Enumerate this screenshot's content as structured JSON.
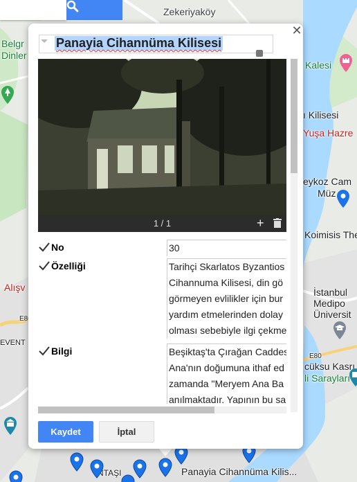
{
  "map": {
    "labels": {
      "zekeriyakoy": "Zekeriyaköy",
      "belgrad": "Belgr",
      "dinler": "Dinler",
      "kalesi": "Kalesi",
      "kilisesi": "ı Kilisesi",
      "yusa": "Yuşa Hazre",
      "beykoz": "eykoz Cam",
      "muze": "Müz",
      "koimisis": "Koimisis The",
      "alisveris": "Alışv",
      "istanbul": "İstanbul",
      "medipol": "Medipo",
      "universite": "Üniversit",
      "e80a": "E80",
      "e80b": "E80",
      "event": "EVENT",
      "kucuksu": "cüksu Kasrı",
      "saray": "li Sarayları",
      "antasi": "NTAŞI",
      "marker_label": "Panayia Cihannüma Kilis..."
    }
  },
  "dialog": {
    "title": "Panayia Cihannüma Kilisesi",
    "photo_counter": "1 / 1",
    "photo_add": "+",
    "fields": [
      {
        "name": "No",
        "lines": [
          "30"
        ]
      },
      {
        "name": "Özelliği",
        "lines": [
          "Tarihçi Skarlatos Byzantios",
          "Cihannuma Kilisesi, din gö",
          "görmeyen evlilikler için bur",
          "yardım etmelerinden dolay",
          "olması sebebiyle ilgi çekme"
        ]
      },
      {
        "name": "Bilgi",
        "lines": [
          "Beşiktaş'ta Çırağan Caddes",
          "Ana'nın doğumuna ithaf ed",
          "zamanda \"Meryem Ana Ba",
          "anılmaktadır. Yapının bu sa"
        ]
      }
    ],
    "save_label": "Kaydet",
    "cancel_label": "İptal"
  },
  "colors": {
    "accent": "#4285f4",
    "pin": "#1a73e8"
  },
  "icons": [
    "search-icon",
    "close-icon",
    "dropdown-arrow-icon",
    "resize-handle-icon",
    "plus-icon",
    "trash-icon",
    "checkmark-icon",
    "map-pin-icon",
    "tree-icon",
    "castle-icon",
    "church-icon",
    "museum-icon",
    "graduation-cap-icon",
    "bank-icon"
  ]
}
